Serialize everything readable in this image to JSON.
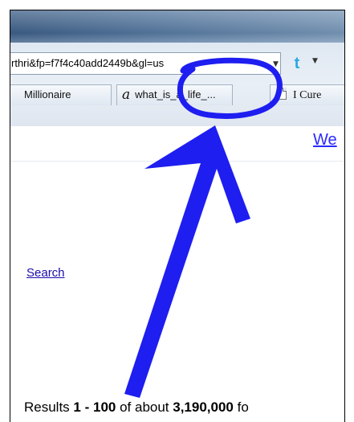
{
  "browser": {
    "address_bar": {
      "value": "rthri&fp=f7f4c40add2449b&gl=us"
    },
    "twitter_button": {
      "icon": "twitter-icon"
    },
    "tabs": [
      {
        "label": "Millionaire"
      },
      {
        "icon": "amazon-a-icon",
        "icon_glyph": "a",
        "label": "what_is_a_life_..."
      },
      {
        "icon": "page-icon",
        "label": "I Cure"
      }
    ]
  },
  "page": {
    "welcome_link": "We",
    "search_link": "Search",
    "results": {
      "prefix": "Results ",
      "range": "1 - 100",
      "middle": " of about ",
      "total": "3,190,000",
      "suffix": " fo"
    }
  },
  "annotation": {
    "color": "#1e1ef0",
    "shapes": [
      "circle-highlight",
      "arrow"
    ]
  }
}
